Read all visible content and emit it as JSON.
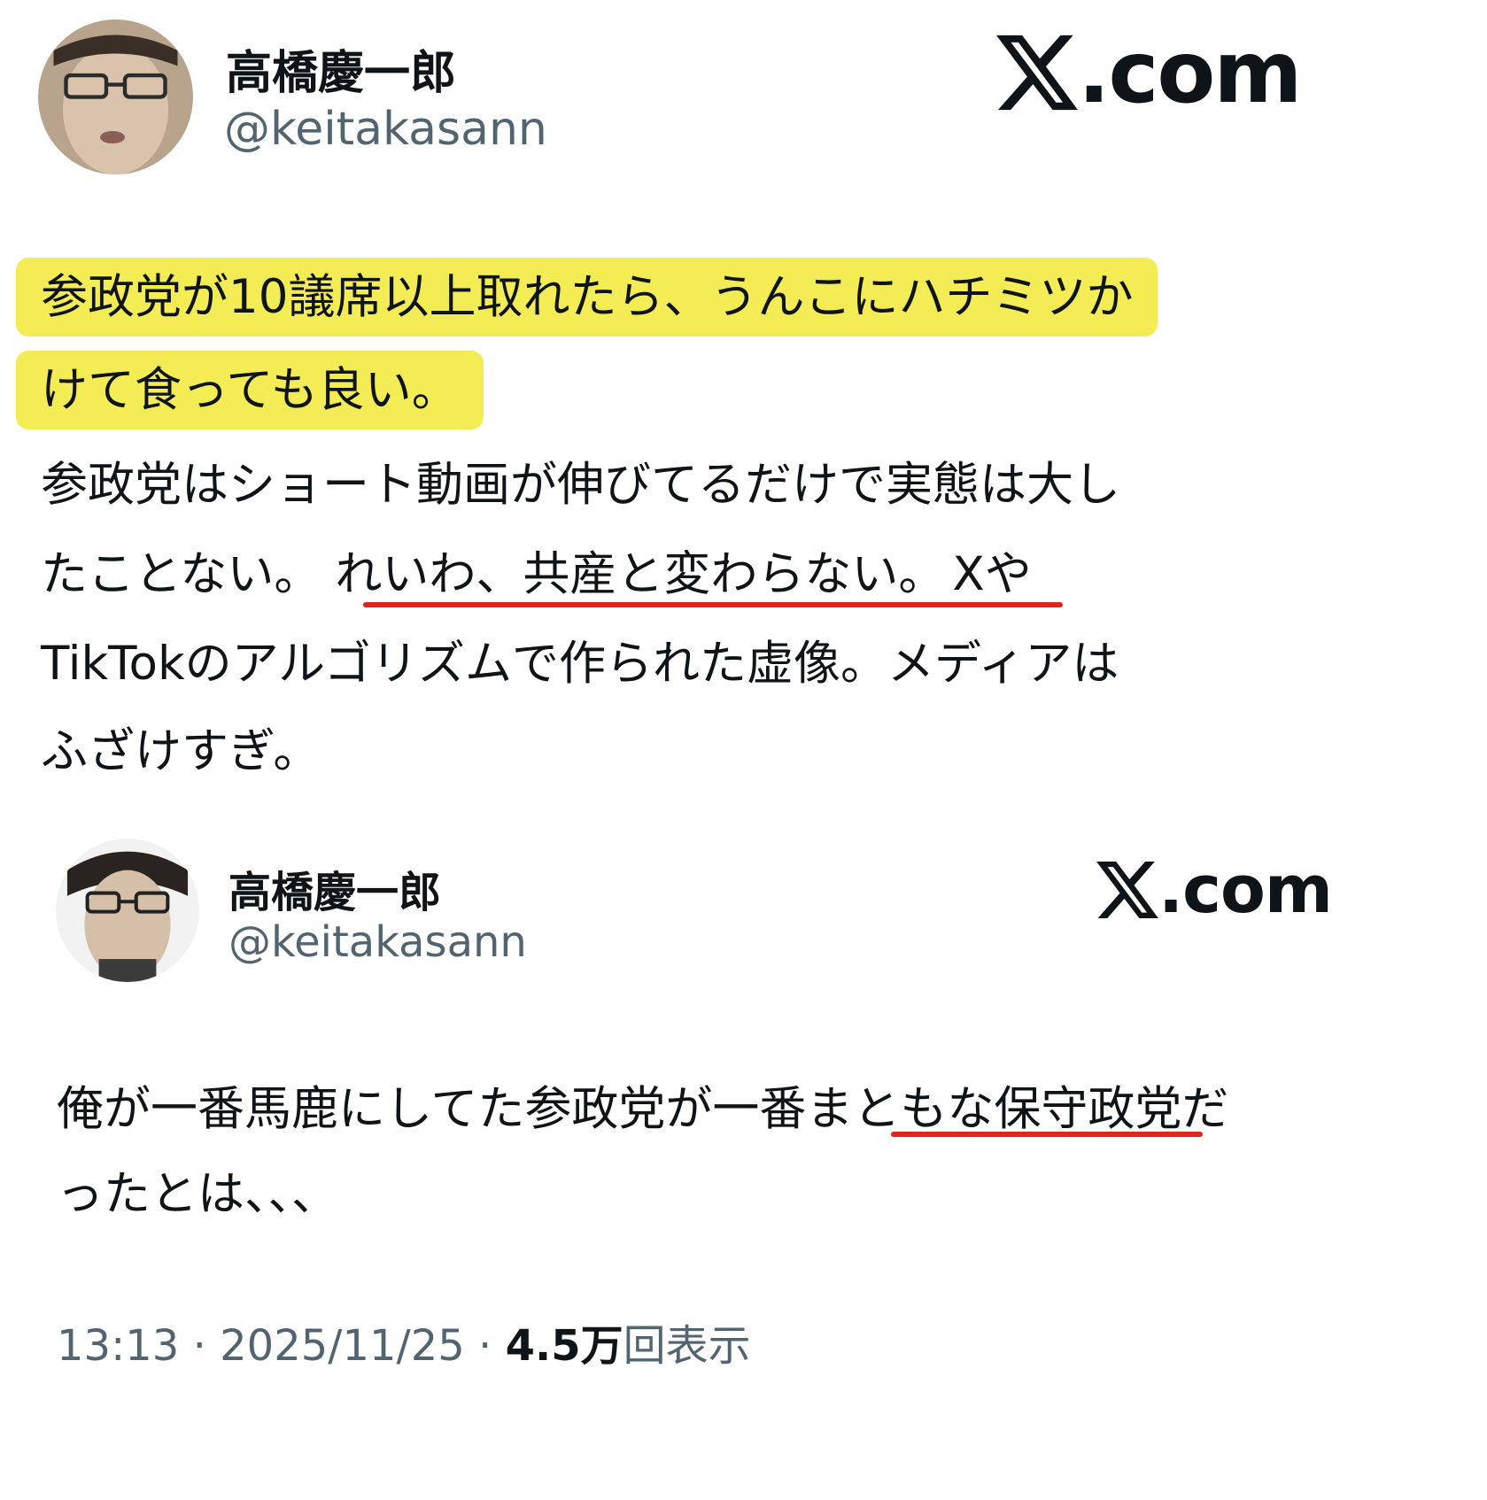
{
  "colors": {
    "highlight": "#f3ec55",
    "underline": "#e3241b",
    "text": "#0f1419",
    "secondary": "#536471"
  },
  "tweet1": {
    "avatar_icon": "user-avatar-photo",
    "name": "高橋慶一郎",
    "handle": "@keitakasann",
    "site": ".com",
    "site_icon": "x-logo-icon",
    "highlighted_lines": [
      "参政党が10議席以上取れたら、うんこにハチミツか",
      "けて食っても良い。"
    ],
    "line3": "参政党はショート動画が伸びてるだけで実態は大し",
    "line4_pre": "たことない。",
    "line4_underlined": "れいわ、共産と変わらない。",
    "line4_post": "Xや",
    "line5": "TikTokのアルゴリズムで作られた虚像。メディアは",
    "line6": "ふざけすぎ。"
  },
  "tweet2": {
    "avatar_icon": "user-avatar-photo",
    "name": "高橋慶一郎",
    "handle": "@keitakasann",
    "site": ".com",
    "site_icon": "x-logo-icon",
    "line1_pre": "俺が一番馬鹿にしてた参政党が一番",
    "line1_underlined": "まともな保守政",
    "line1_post": "党だ",
    "line2": "ったとは、、、",
    "time": "13:13",
    "sep1": "·",
    "date": "2025/11/25",
    "sep2": "·",
    "views": "4.5万",
    "views_label": "回表示"
  }
}
